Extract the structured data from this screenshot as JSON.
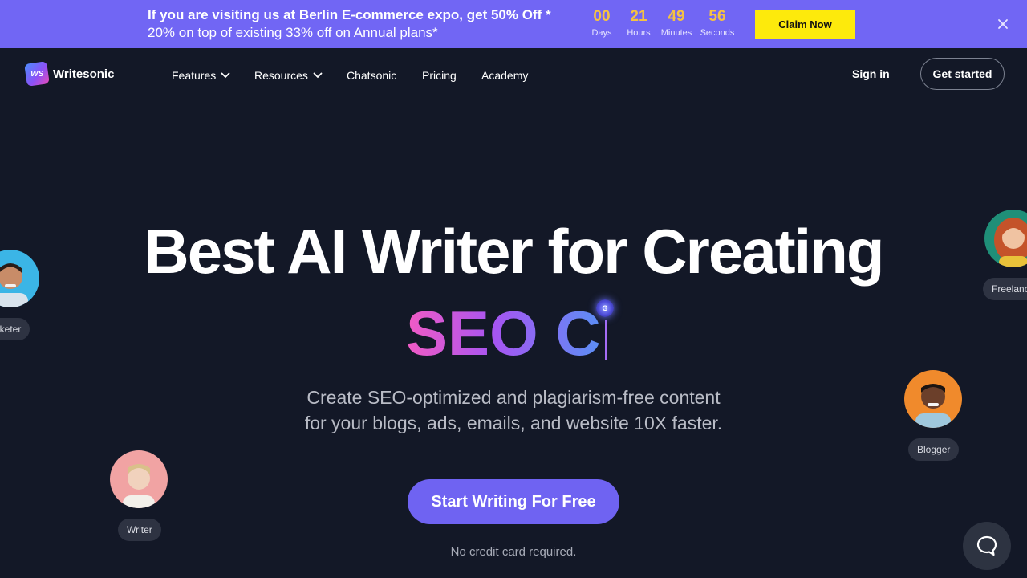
{
  "banner": {
    "line1": "If you are visiting us at Berlin E-commerce expo, get 50% Off *",
    "line2": "20% on top of existing 33% off on Annual plans*",
    "countdown": [
      {
        "value": "00",
        "unit": "Days"
      },
      {
        "value": "21",
        "unit": "Hours"
      },
      {
        "value": "49",
        "unit": "Minutes"
      },
      {
        "value": "56",
        "unit": "Seconds"
      }
    ],
    "claim_label": "Claim Now",
    "close_icon": "close-icon"
  },
  "header": {
    "logo_mark": "WS",
    "logo_text": "Writesonic",
    "nav": [
      {
        "label": "Features",
        "dropdown": true
      },
      {
        "label": "Resources",
        "dropdown": true
      },
      {
        "label": "Chatsonic",
        "dropdown": false
      },
      {
        "label": "Pricing",
        "dropdown": false
      },
      {
        "label": "Academy",
        "dropdown": false
      }
    ],
    "signin_label": "Sign in",
    "get_started_label": "Get started"
  },
  "hero": {
    "title": "Best AI Writer for Creating",
    "typed_text": "SEO C",
    "cursor_badge": "G",
    "subtitle_line1": "Create SEO-optimized and plagiarism-free content",
    "subtitle_line2": "for your blogs, ads, emails, and website 10X faster.",
    "cta_label": "Start Writing For Free",
    "note": "No credit card required."
  },
  "personas": [
    {
      "role": "Marketer",
      "visible_label": "arketer"
    },
    {
      "role": "Freelancer",
      "visible_label": "Freelanc"
    },
    {
      "role": "Blogger",
      "visible_label": "Blogger"
    },
    {
      "role": "Writer",
      "visible_label": "Writer"
    }
  ],
  "colors": {
    "background": "#131827",
    "banner": "#7166f4",
    "countdown": "#f5c242",
    "claim_button": "#fdea0c",
    "cta": "#6f63f2"
  },
  "chat_widget_icon": "chat-bubble-icon"
}
